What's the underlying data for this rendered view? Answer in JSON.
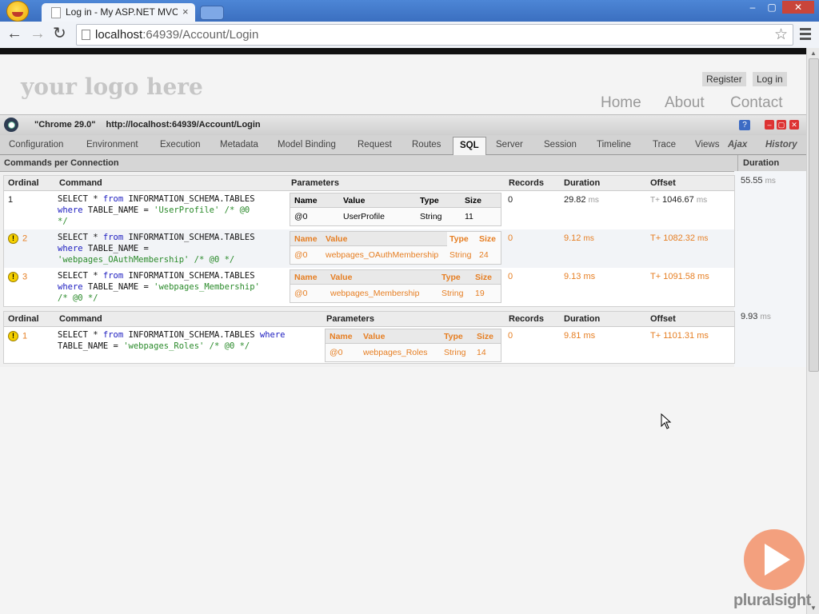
{
  "browser": {
    "tab_title": "Log in - My ASP.NET MVC",
    "tab_close": "×",
    "url_host": "localhost",
    "url_rest": ":64939/Account/Login",
    "win_min": "–",
    "win_max": "▢",
    "win_close": "✕"
  },
  "site": {
    "logo": "your logo here",
    "register": "Register",
    "login": "Log in",
    "nav": [
      "Home",
      "About",
      "Contact"
    ]
  },
  "glimpse": {
    "browser_label": "\"Chrome 29.0\"",
    "request_url": "http://localhost:64939/Account/Login",
    "help": "?",
    "tabs": [
      "Configuration",
      "Environment",
      "Execution",
      "Metadata",
      "Model Binding",
      "Request",
      "Routes",
      "SQL",
      "Server",
      "Session",
      "Timeline",
      "Trace",
      "Views"
    ],
    "active_tab": "SQL",
    "extra_tabs": [
      "Ajax",
      "History"
    ],
    "section_title": "Commands per Connection",
    "duration_header": "Duration",
    "headers": {
      "ordinal": "Ordinal",
      "command": "Command",
      "parameters": "Parameters",
      "records": "Records",
      "duration": "Duration",
      "offset": "Offset"
    },
    "param_headers": {
      "name": "Name",
      "value": "Value",
      "type": "Type",
      "size": "Size"
    },
    "connections": [
      {
        "duration": "55.55",
        "duration_unit": "ms",
        "commands": [
          {
            "ordinal": "1",
            "warning": false,
            "line1a": "SELECT * ",
            "line1b": "from",
            "line1c": " INFORMATION_SCHEMA.TABLES",
            "line2a": "where",
            "line2b": " TABLE_NAME = ",
            "line2c": "'UserProfile'",
            "line2d": " /* @0",
            "line3": "*/",
            "param": {
              "name": "@0",
              "value": "UserProfile",
              "type": "String",
              "size": "11"
            },
            "records": "0",
            "duration": "29.82",
            "unit": "ms",
            "offset_prefix": "T+",
            "offset": "1046.67"
          },
          {
            "ordinal": "2",
            "warning": true,
            "line1a": "SELECT * ",
            "line1b": "from",
            "line1c": " INFORMATION_SCHEMA.TABLES",
            "line2a": "where",
            "line2b": " TABLE_NAME =",
            "line2c": "",
            "line2d": "",
            "line3": "'webpages_OAuthMembership' /* @0 */",
            "param": {
              "name": "@0",
              "value": "webpages_OAuthMembership",
              "type": "String",
              "size": "24"
            },
            "records": "0",
            "duration": "9.12",
            "unit": "ms",
            "offset_prefix": "T+",
            "offset": "1082.32"
          },
          {
            "ordinal": "3",
            "warning": true,
            "line1a": "SELECT * ",
            "line1b": "from",
            "line1c": " INFORMATION_SCHEMA.TABLES",
            "line2a": "where",
            "line2b": " TABLE_NAME = ",
            "line2c": "'webpages_Membership'",
            "line2d": "",
            "line3": "/* @0 */",
            "param": {
              "name": "@0",
              "value": "webpages_Membership",
              "type": "String",
              "size": "19"
            },
            "records": "0",
            "duration": "9.13",
            "unit": "ms",
            "offset_prefix": "T+",
            "offset": "1091.58"
          }
        ]
      },
      {
        "duration": "9.93",
        "duration_unit": "ms",
        "commands": [
          {
            "ordinal": "1",
            "warning": true,
            "line1a": "SELECT * ",
            "line1b": "from",
            "line1c": " INFORMATION_SCHEMA.TABLES ",
            "line1d": "where",
            "line2a": "TABLE_NAME = ",
            "line2c": "'webpages_Roles'",
            "line2d": " /* @0 */",
            "param": {
              "name": "@0",
              "value": "webpages_Roles",
              "type": "String",
              "size": "14"
            },
            "records": "0",
            "duration": "9.81",
            "unit": "ms",
            "offset_prefix": "T+",
            "offset": "1101.31"
          }
        ]
      }
    ]
  },
  "watermark": {
    "text": "pluralsight"
  }
}
